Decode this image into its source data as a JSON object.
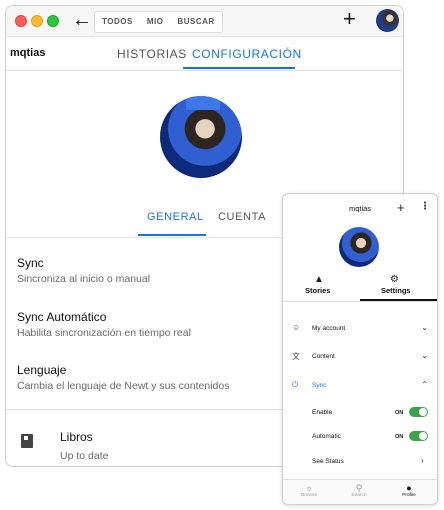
{
  "window": {
    "nav": [
      "TODOS",
      "MIO",
      "BUSCAR"
    ],
    "plus": "+",
    "back": "←"
  },
  "tabs": {
    "user": "mqtias",
    "historias": "HISTORIAS",
    "configuracion": "CONFIGURACIÓN"
  },
  "subtabs": {
    "general": "GENERAL",
    "cuenta": "CUENTA"
  },
  "settings": [
    {
      "title": "Sync",
      "subtitle": "Sincroniza al inicio o manual"
    },
    {
      "title": "Sync Automático",
      "subtitle": "Habilita sincronización en tiempo real"
    },
    {
      "title": "Lenguaje",
      "subtitle": "Cambia el lenguaje de Newt y sus contenidos"
    }
  ],
  "library": {
    "title": "Libros",
    "subtitle": "Up to date"
  },
  "phone": {
    "title": "mqtias",
    "plus": "+",
    "more": "⋮",
    "tabs": {
      "stories": "Stories",
      "settings": "Settings"
    },
    "rows": [
      {
        "label": "My account",
        "icon": "account-circle-icon",
        "chev": "⌄"
      },
      {
        "label": "Content",
        "icon": "translate-icon",
        "chev": "⌄"
      },
      {
        "label": "Sync",
        "icon": "power-icon",
        "chev": "⌃"
      }
    ],
    "sync": {
      "enable": "Enable",
      "automatic": "Automatic",
      "on": "ON",
      "see_status": "See Status",
      "chev": "›"
    },
    "nav": [
      {
        "label": "Browse"
      },
      {
        "label": "Search"
      },
      {
        "label": "Profile"
      }
    ]
  },
  "colors": {
    "accent": "#1a73e8",
    "toggle": "#3aa547"
  }
}
